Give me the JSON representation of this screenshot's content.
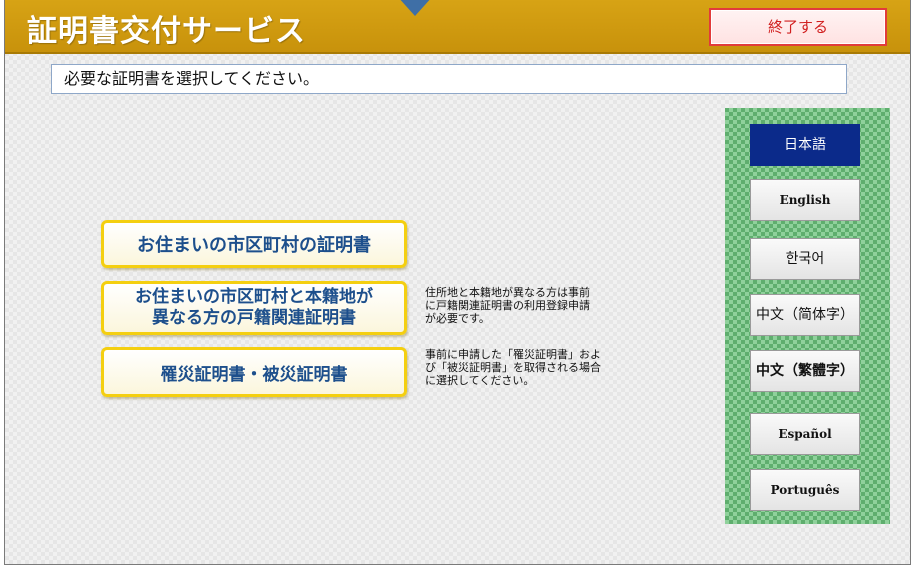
{
  "header": {
    "title": "証明書交付サービス",
    "exit_label": "終了する"
  },
  "instruction": "必要な証明書を選択してください。",
  "certificates": [
    {
      "label": "お住まいの市区町村の証明書",
      "note": ""
    },
    {
      "label": "お住まいの市区町村と本籍地が\n異なる方の戸籍関連証明書",
      "note": "住所地と本籍地が異なる方は事前\nに戸籍関連証明書の利用登録申請\nが必要です。"
    },
    {
      "label": "罹災証明書・被災証明書",
      "note": "事前に申請した「罹災証明書」およ\nび「被災証明書」を取得される場合\nに選択してください。"
    }
  ],
  "languages": [
    {
      "label": "日本語",
      "active": true
    },
    {
      "label": "English",
      "active": false
    },
    {
      "label": "한국어",
      "active": false
    },
    {
      "label": "中文（简体字）",
      "active": false
    },
    {
      "label": "中文（繁體字）",
      "active": false
    },
    {
      "label": "Español",
      "active": false
    },
    {
      "label": "Português",
      "active": false
    }
  ],
  "colors": {
    "header": "#c8920b",
    "button_border": "#f4cf10",
    "button_text": "#1d4f8c",
    "active_language": "#0b2a8a",
    "exit_border": "#e23b3b"
  }
}
